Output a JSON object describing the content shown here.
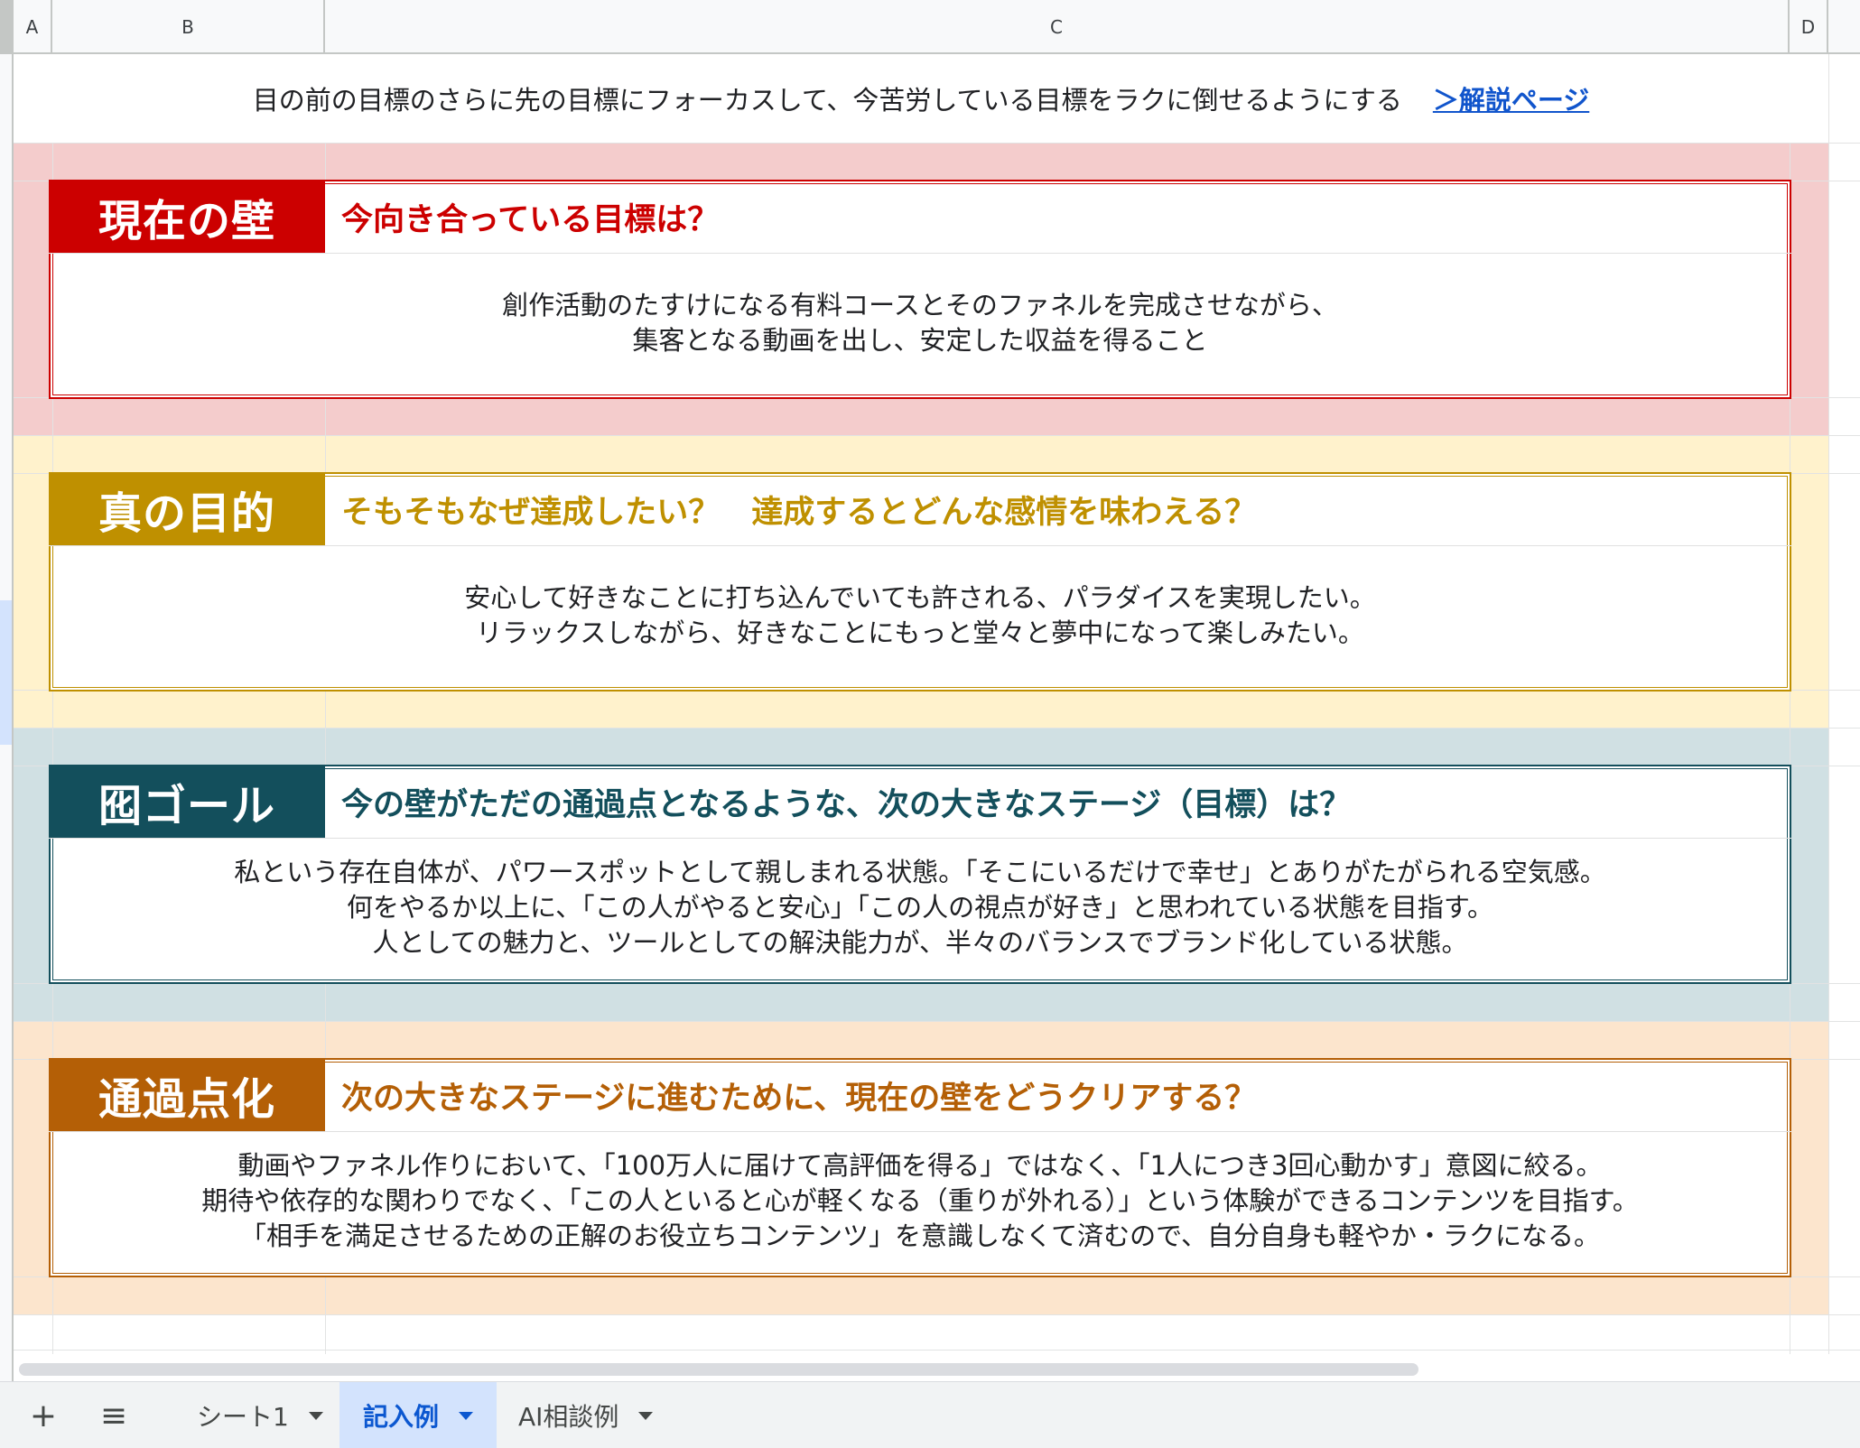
{
  "columns": [
    "A",
    "B",
    "C",
    "D"
  ],
  "intro": {
    "text": "目の前の目標のさらに先の目標にフォーカスして、今苦労している目標をラクに倒せるようにする",
    "link": "＞解説ページ"
  },
  "sections": [
    {
      "label": "現在の壁",
      "question": "今向き合っている目標は？",
      "lines": [
        "創作活動のたすけになる有料コースとそのファネルを完成させながら、",
        "集客となる動画を出し、安定した収益を得ること"
      ],
      "accent": "#cc0000",
      "band": "#f4cccc"
    },
    {
      "label": "真の目的",
      "question": "そもそもなぜ達成したい？　達成するとどんな感情を味わえる？",
      "lines": [
        "安心して好きなことに打ち込んでいても許される、パラダイスを実現したい。",
        "リラックスしながら、好きなことにもっと堂々と夢中になって楽しみたい。"
      ],
      "accent": "#bf9000",
      "band": "#fff2cc"
    },
    {
      "label": "囮ゴール",
      "question": "今の壁がただの通過点となるような、次の大きなステージ（目標）は？",
      "lines": [
        "私という存在自体が、パワースポットとして親しまれる状態。「そこにいるだけで幸せ」とありがたがられる空気感。",
        "何をやるか以上に、「この人がやると安心」「この人の視点が好き」と思われている状態を目指す。",
        "人としての魅力と、ツールとしての解決能力が、半々のバランスでブランド化している状態。"
      ],
      "accent": "#134f5c",
      "band": "#d0e0e3"
    },
    {
      "label": "通過点化",
      "question": "次の大きなステージに進むために、現在の壁をどうクリアする？",
      "lines": [
        "動画やファネル作りにおいて、「100万人に届けて高評価を得る」ではなく、「1人につき3回心動かす」意図に絞る。",
        "期待や依存的な関わりでなく、「この人といると心が軽くなる（重りが外れる）」という体験ができるコンテンツを目指す。",
        "「相手を満足させるための正解のお役立ちコンテンツ」を意識しなくて済むので、自分自身も軽やか・ラクになる。"
      ],
      "accent": "#b45f06",
      "band": "#fce5cd"
    }
  ],
  "tabs": [
    {
      "label": "シート1",
      "active": false
    },
    {
      "label": "記入例",
      "active": true
    },
    {
      "label": "AI相談例",
      "active": false
    }
  ],
  "toolbar": {
    "add_label": "+",
    "menu_label": "≡"
  }
}
